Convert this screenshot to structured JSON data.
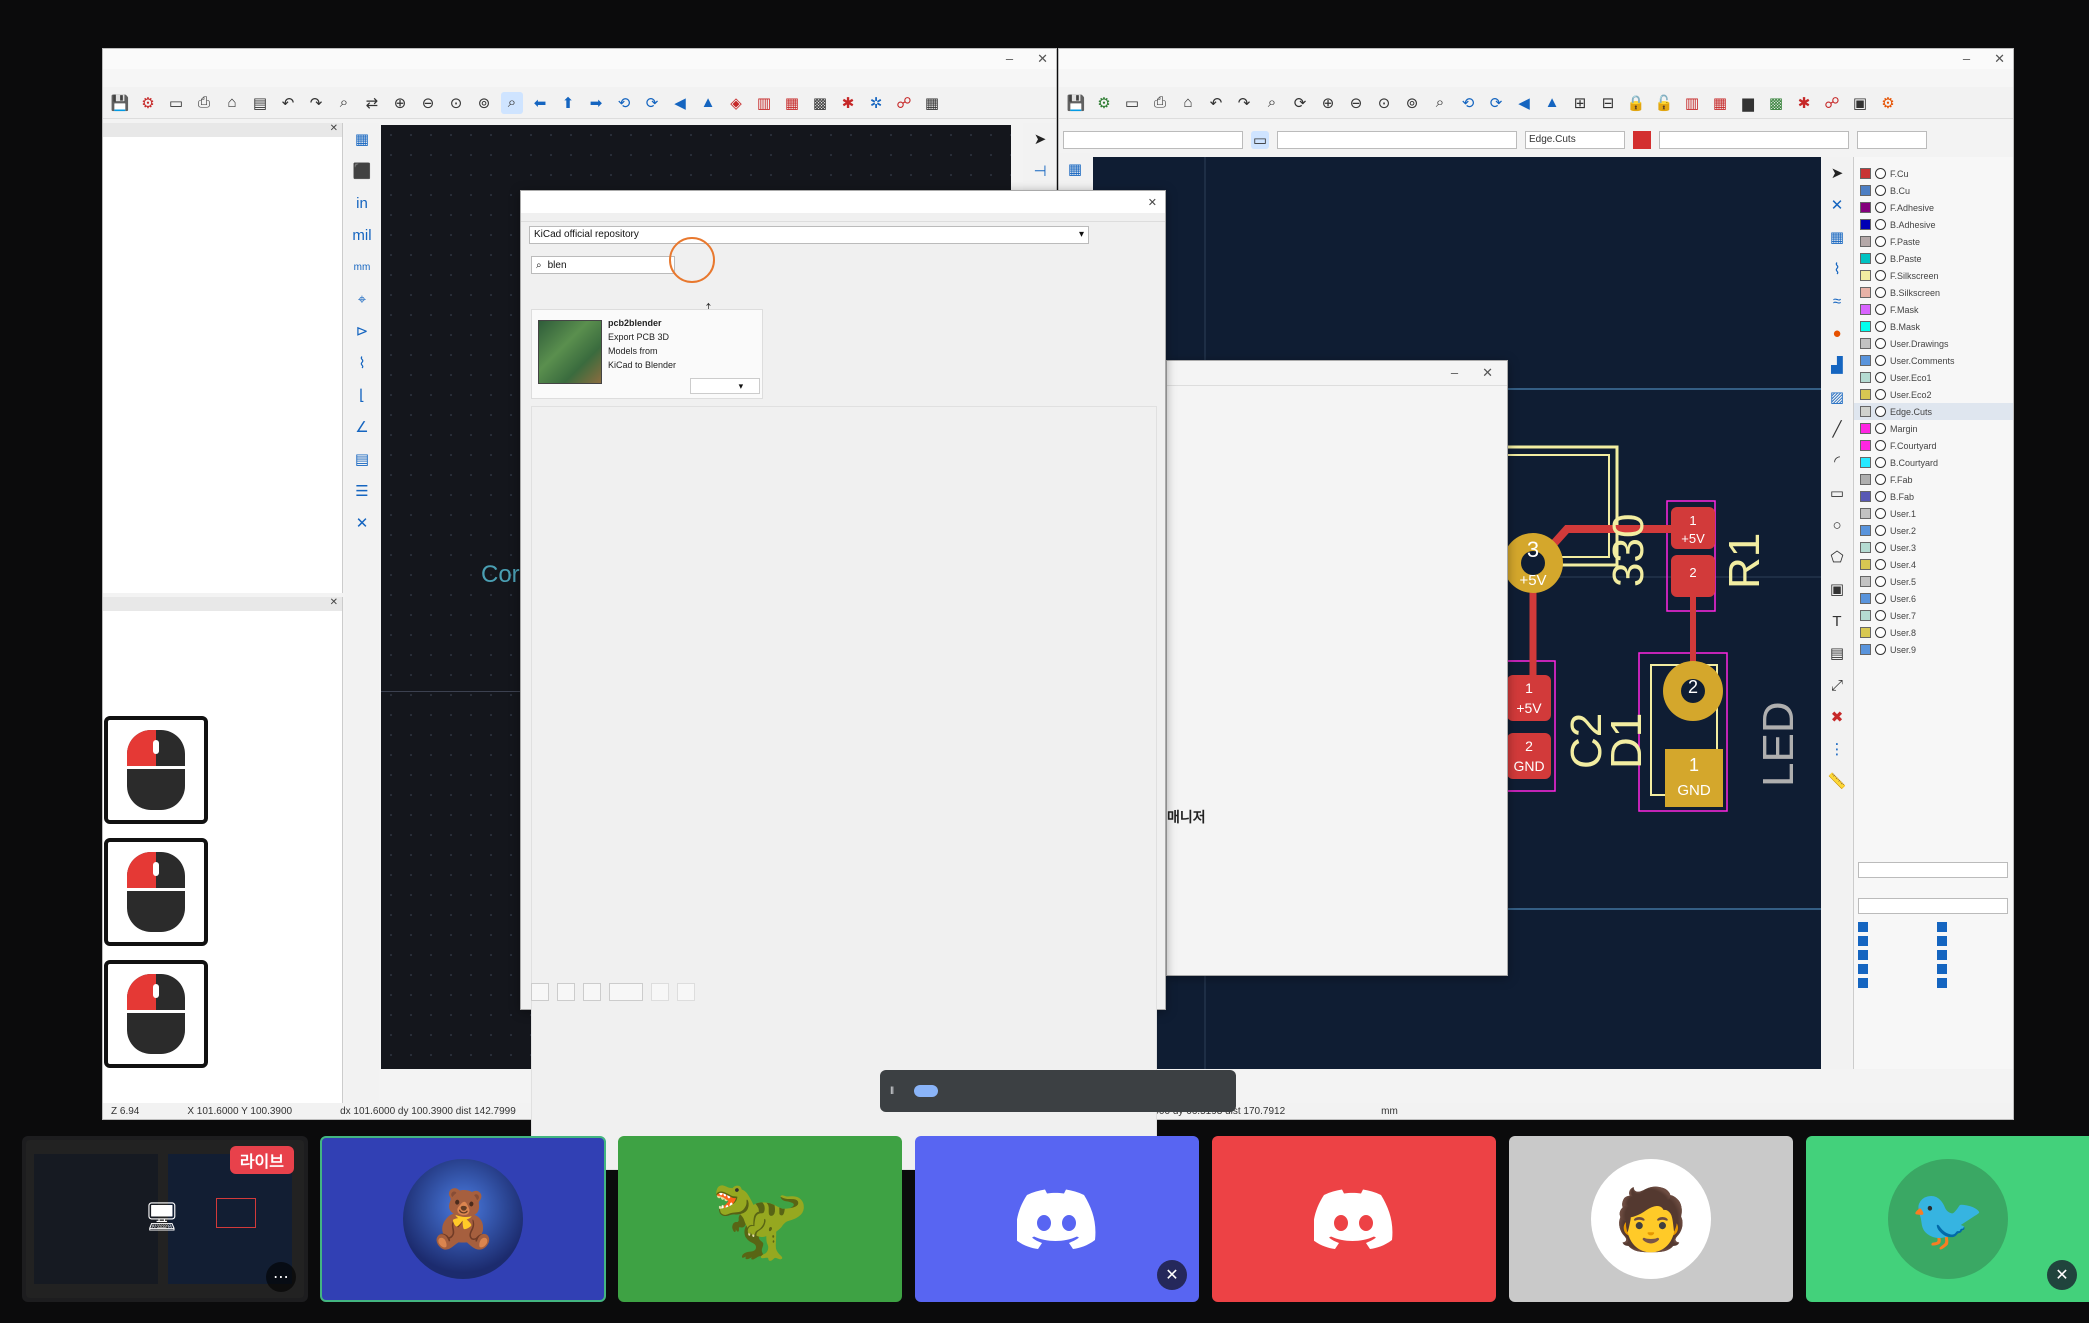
{
  "left_window": {
    "title": "",
    "menus": [],
    "panel_top_title": "",
    "tree_item": "",
    "panel_bottom_title": "",
    "panel_bottom_text": "",
    "canvas_text": "Cor",
    "status": {
      "zoom": "Z 6.94",
      "xy": "X 101.6000 Y 100.3900",
      "dxy": "dx 101.6000 dy 100.3900 dist 142.7999",
      "grid": "",
      "units": "mm"
    }
  },
  "right_window": {
    "title": "",
    "menus": [],
    "aux_track_value": "",
    "aux_layer_value": "",
    "aux_via_value": "",
    "aux_zoom_value": "",
    "layers_tabs": [],
    "layers": [
      {
        "name": "F.Cu",
        "color": "#c83434"
      },
      {
        "name": "B.Cu",
        "color": "#4d7fc4"
      },
      {
        "name": "F.Adhesive",
        "color": "#84007c"
      },
      {
        "name": "B.Adhesive",
        "color": "#0000b4"
      },
      {
        "name": "F.Paste",
        "color": "#b4a8a8"
      },
      {
        "name": "B.Paste",
        "color": "#00c2c2"
      },
      {
        "name": "F.Silkscreen",
        "color": "#f2eda1"
      },
      {
        "name": "B.Silkscreen",
        "color": "#e8b2a7"
      },
      {
        "name": "F.Mask",
        "color": "#d864ff"
      },
      {
        "name": "B.Mask",
        "color": "#02ffee"
      },
      {
        "name": "User.Drawings",
        "color": "#c2c2c2"
      },
      {
        "name": "User.Comments",
        "color": "#5994dc"
      },
      {
        "name": "User.Eco1",
        "color": "#b4dbd2"
      },
      {
        "name": "User.Eco2",
        "color": "#d8c852"
      },
      {
        "name": "Edge.Cuts",
        "color": "#d0d2cd"
      },
      {
        "name": "Margin",
        "color": "#ff26e2"
      },
      {
        "name": "F.Courtyard",
        "color": "#ff26e2"
      },
      {
        "name": "B.Courtyard",
        "color": "#26e9ff"
      },
      {
        "name": "F.Fab",
        "color": "#afafaf"
      },
      {
        "name": "B.Fab",
        "color": "#5858b4"
      },
      {
        "name": "User.1",
        "color": "#c2c2c2"
      },
      {
        "name": "User.2",
        "color": "#5994dc"
      },
      {
        "name": "User.3",
        "color": "#b4dbd2"
      },
      {
        "name": "User.4",
        "color": "#d8c852"
      },
      {
        "name": "User.5",
        "color": "#c2c2c2"
      },
      {
        "name": "User.6",
        "color": "#5994dc"
      },
      {
        "name": "User.7",
        "color": "#b4dbd2"
      },
      {
        "name": "User.8",
        "color": "#d8c852"
      },
      {
        "name": "User.9",
        "color": "#5994dc"
      }
    ],
    "preset_label": "",
    "preset_value": "",
    "display_section": "",
    "status": {
      "xy": "",
      "dxy": "dx 146.0000 dy 66.5193 dist 170.7912",
      "grid": "",
      "units": "mm"
    }
  },
  "pcb": {
    "pad3_num": "3",
    "pad3_net": "+5V",
    "r1_pad1_num": "1",
    "r1_pad1_net": "+5V",
    "r1_pad2_num": "2",
    "c2_pad1_num": "1",
    "c2_pad1_net": "+5V",
    "c2_pad2_num": "2",
    "c2_pad2_net": "GND",
    "d1_pad2_num": "2",
    "d1_pad1_num": "1",
    "d1_pad1_net": "GND",
    "silk_330": "330",
    "silk_r1": "R1",
    "silk_c2": "C2",
    "silk_d1": "D1",
    "silk_led": "LED"
  },
  "dialog": {
    "title": "",
    "tabs": [
      "",
      ""
    ],
    "repository": "KiCad official repository",
    "manage_button": "",
    "filter_tabs": "",
    "search_value": "blen",
    "update_button": "",
    "package": {
      "name": "pcb2blender",
      "description": "Export PCB 3D Models from KiCad to Blender",
      "action": ""
    },
    "footer_buttons": [
      "",
      "",
      "",
      "",
      "",
      ""
    ]
  },
  "back_dialog": {
    "lines": [
      "",
      "",
      "",
      "",
      "",
      "",
      ""
    ],
    "bold_text": "매니저",
    "bottom_text": ""
  },
  "share_bar": {
    "text": "",
    "stop_button": "",
    "hide_link": ""
  },
  "tiles": {
    "live_badge": "라이브"
  }
}
